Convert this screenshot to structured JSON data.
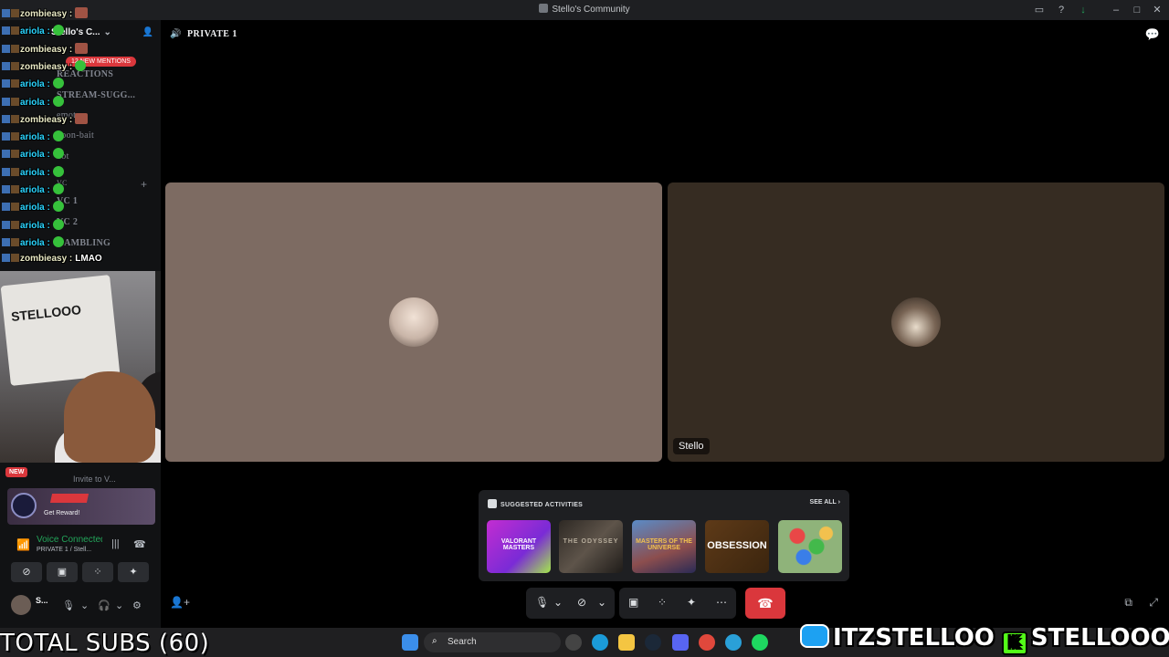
{
  "window": {
    "title": "Stello's Community"
  },
  "server": {
    "name": "Stello's C...",
    "mentions_pill": "12 NEW MENTIONS",
    "channels": [
      "REACTIONS",
      "STREAM-SUGG...",
      "emotes",
      "goon-bait",
      "bot",
      "VC",
      "VC 1",
      "VC 2",
      "GAMBLING"
    ],
    "new_badge": "NEW",
    "invite": "Invite to V..."
  },
  "chat": [
    {
      "user": "zombieasy :",
      "color": "u2",
      "emote": "sq",
      "msg": ""
    },
    {
      "user": "ariola :",
      "color": "u1",
      "emote": "round",
      "msg": ""
    },
    {
      "user": "zombieasy :",
      "color": "u2",
      "emote": "sq",
      "msg": ""
    },
    {
      "user": "zombieasy :",
      "color": "u2",
      "emote": "round",
      "msg": ""
    },
    {
      "user": "ariola :",
      "color": "u1",
      "emote": "round",
      "msg": ""
    },
    {
      "user": "ariola :",
      "color": "u1",
      "emote": "round",
      "msg": ""
    },
    {
      "user": "zombieasy :",
      "color": "u2",
      "emote": "sq",
      "msg": ""
    },
    {
      "user": "ariola :",
      "color": "u1",
      "emote": "round",
      "msg": ""
    },
    {
      "user": "ariola :",
      "color": "u1",
      "emote": "round",
      "msg": ""
    },
    {
      "user": "ariola :",
      "color": "u1",
      "emote": "round",
      "msg": ""
    },
    {
      "user": "ariola :",
      "color": "u1",
      "emote": "round",
      "msg": ""
    },
    {
      "user": "ariola :",
      "color": "u1",
      "emote": "round",
      "msg": ""
    },
    {
      "user": "ariola :",
      "color": "u1",
      "emote": "round",
      "msg": ""
    },
    {
      "user": "ariola :",
      "color": "u1",
      "emote": "round",
      "msg": ""
    },
    {
      "user": "zombieasy :",
      "color": "u2",
      "emote": "none",
      "msg": "LMAO"
    }
  ],
  "reward": {
    "label": "Get Reward!"
  },
  "voice": {
    "status": "Voice Connected",
    "channel": "PRIVATE 1 / Stell..."
  },
  "user": {
    "name": "S..."
  },
  "channel_header": {
    "name": "PRIVATE 1"
  },
  "tiles": [
    {
      "name": ""
    },
    {
      "name": "Stello"
    }
  ],
  "activities": {
    "heading": "SUGGESTED ACTIVITIES",
    "see_all": "SEE ALL",
    "items": [
      {
        "label": "VALORANT MASTERS"
      },
      {
        "label": "THE ODYSSEY"
      },
      {
        "label": "MASTERS OF THE UNIVERSE"
      },
      {
        "label": "OBSESSION"
      },
      {
        "label": ""
      }
    ]
  },
  "taskbar": {
    "search_placeholder": "Search"
  },
  "overlay": {
    "total_subs": "TOTAL SUBS (60)",
    "twitter": "ITZSTELLOO",
    "kick": "STELLOOO"
  },
  "colors": {
    "accent_red": "#da373c",
    "voice_green": "#23a55a",
    "kick_green": "#53fc18",
    "twitter_blue": "#1da1f2"
  }
}
